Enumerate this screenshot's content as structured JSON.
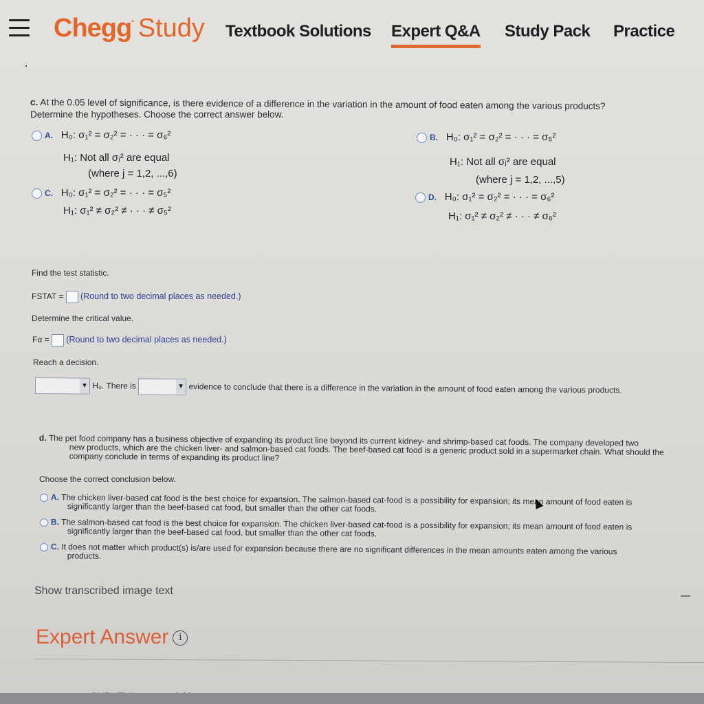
{
  "nav": {
    "menu_icon": "hamburger-icon",
    "logo_bold": "Chegg",
    "logo_light": "Study",
    "links": [
      {
        "label": "Textbook Solutions",
        "active": false
      },
      {
        "label": "Expert Q&A",
        "active": true
      },
      {
        "label": "Study Pack",
        "active": false
      },
      {
        "label": "Practice",
        "active": false
      }
    ],
    "accent_color": "#e0672e"
  },
  "part_c": {
    "label": "c.",
    "question_line1": "At the 0.05 level of significance, is there evidence of a difference in the variation in the amount of food eaten among the various products?",
    "question_line2": "Determine the hypotheses. Choose the correct answer below.",
    "options": [
      {
        "letter": "A.",
        "h0": "H₀: σ₁² = σ₂² = · · · = σ₆²",
        "h1": "H₁: Not all σⱼ² are equal",
        "note": "(where j = 1,2, ...,6)"
      },
      {
        "letter": "B.",
        "h0": "H₀: σ₁² = σ₂² = · · · = σ₅²",
        "h1": "H₁: Not all σⱼ² are equal",
        "note": "(where j = 1,2, ...,5)"
      },
      {
        "letter": "C.",
        "h0": "H₀: σ₁² = σ₂² = · · · = σ₅²",
        "h1": "H₁: σ₁² ≠ σ₂² ≠ · · · ≠ σ₅²"
      },
      {
        "letter": "D.",
        "h0": "H₀: σ₁² = σ₂² = · · · = σ₆²",
        "h1": "H₁: σ₁² ≠ σ₂² ≠ · · · ≠ σ₆²"
      }
    ],
    "find_stat": "Find the test statistic.",
    "fstat_label": "FSTAT =",
    "fstat_value": "",
    "round_hint": "(Round to two decimal places as needed.)",
    "critical_prompt": "Determine the critical value.",
    "falpha_label": "Fα =",
    "falpha_value": "",
    "decision_prompt": "Reach a decision.",
    "decision_select1": "",
    "decision_mid": "H₀. There is",
    "decision_select2": "",
    "decision_end": "evidence to conclude that there is a difference in the variation in the amount of food eaten among the various products."
  },
  "part_d": {
    "label": "d.",
    "question_lines": [
      "The pet food company has a business objective of expanding its product line beyond its current kidney- and shrimp-based cat foods. The company developed two",
      "new products, which are the chicken liver- and salmon-based cat foods. The beef-based cat food is a generic product sold in a supermarket chain. What should the",
      "company conclude in terms of expanding its product line?"
    ],
    "prompt": "Choose the correct conclusion below.",
    "options": [
      {
        "letter": "A.",
        "line1": "The chicken liver-based cat food is the best choice for expansion. The salmon-based cat-food is a possibility for expansion; its mean amount of food eaten is",
        "line2": "significantly larger than the beef-based cat food, but smaller than the other cat foods."
      },
      {
        "letter": "B.",
        "line1": "The salmon-based cat food is the best choice for expansion. The chicken liver-based cat-food is a possibility for expansion; its mean amount of food eaten is",
        "line2": "significantly larger than the beef-based cat food, but smaller than the other cat foods."
      },
      {
        "letter": "C.",
        "line1": "It does not matter which product(s) is/are used for expansion because there are no significant differences in the mean amounts eaten among the various",
        "line2": "products."
      }
    ]
  },
  "footer": {
    "show_transcribed": "Show transcribed image text",
    "expert_answer": "Expert Answer",
    "info_icon": "i",
    "answered_by": "SHRUTHI answered this"
  }
}
